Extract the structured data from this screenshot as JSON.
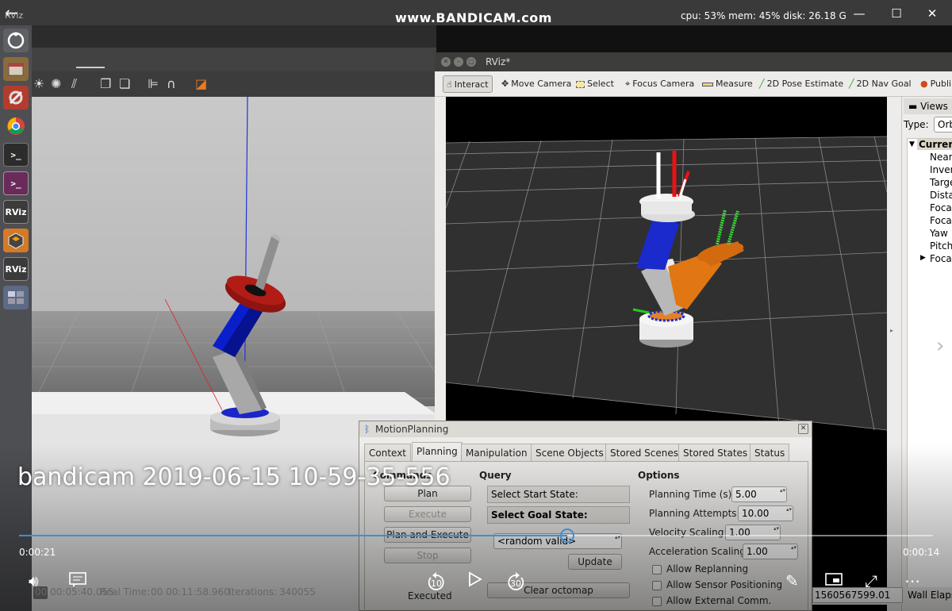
{
  "topbar": {
    "rviz_label": "RViz",
    "watermark": "www.BANDICAM.com",
    "stats": "cpu: 53% mem: 45% disk: 26.18 G",
    "back_icon": "back-arrow-icon",
    "minimize_icon": "minimize-icon",
    "maximize_icon": "maximize-icon",
    "close_icon": "close-icon"
  },
  "launcher": {
    "items": [
      {
        "icon": "ubuntu-dash-icon",
        "label": ""
      },
      {
        "icon": "files-icon",
        "label": ""
      },
      {
        "icon": "settings-tools-icon",
        "label": ""
      },
      {
        "icon": "chrome-icon",
        "label": ""
      },
      {
        "icon": "terminal-icon",
        "label": ""
      },
      {
        "icon": "terminal-alt-icon",
        "label": ""
      },
      {
        "icon": "rviz-icon",
        "label": "RViz"
      },
      {
        "icon": "gazebo-icon",
        "label": ""
      },
      {
        "icon": "rviz-icon",
        "label": "RViz"
      },
      {
        "icon": "workspace-icon",
        "label": ""
      }
    ]
  },
  "gazebo": {
    "status": {
      "sim_time_value": "00 00:05:40.055",
      "real_time_label": "Real Time:",
      "real_time_value": "00 00:11:58.960",
      "iterations_label": "Iterations:",
      "iterations_value": "340055"
    }
  },
  "rviz": {
    "title": "RViz*",
    "tools": [
      {
        "label": "Interact",
        "icon": "interact-icon",
        "active": true
      },
      {
        "label": "Move Camera",
        "icon": "move-camera-icon",
        "active": false
      },
      {
        "label": "Select",
        "icon": "select-icon",
        "active": false
      },
      {
        "label": "Focus Camera",
        "icon": "focus-camera-icon",
        "active": false
      },
      {
        "label": "Measure",
        "icon": "measure-icon",
        "active": false
      },
      {
        "label": "2D Pose Estimate",
        "icon": "pose-estimate-icon",
        "active": false
      },
      {
        "label": "2D Nav Goal",
        "icon": "nav-goal-icon",
        "active": false
      },
      {
        "label": "Publi",
        "icon": "publish-point-icon",
        "active": false
      }
    ],
    "views": {
      "header": "Views",
      "type_label": "Type:",
      "type_value": "Orb",
      "tree": [
        "Current",
        "Near",
        "Inver",
        "Targe",
        "Dista",
        "Foca",
        "Foca",
        "Yaw",
        "Pitch",
        "Foca"
      ]
    },
    "bottom": {
      "wall_time": "1560567599.01",
      "wall_elapsed": "Wall Elaps"
    }
  },
  "motion_planning": {
    "title": "MotionPlanning",
    "tabs": [
      "Context",
      "Planning",
      "Manipulation",
      "Scene Objects",
      "Stored Scenes",
      "Stored States",
      "Status"
    ],
    "selected_tab": "Planning",
    "commands_label": "Commands",
    "buttons": {
      "plan": "Plan",
      "execute": "Execute",
      "plan_and_execute": "Plan and Execute",
      "stop": "Stop",
      "update": "Update",
      "clear_octomap": "Clear octomap"
    },
    "executed_label": "Executed",
    "query": {
      "label": "Query",
      "start_state": "Select Start State:",
      "goal_state": "Select Goal State:",
      "goal_value": "<random valid>"
    },
    "options": {
      "label": "Options",
      "planning_time_label": "Planning Time (s):",
      "planning_time_value": "5.00",
      "planning_attempts_label": "Planning Attempts:",
      "planning_attempts_value": "10.00",
      "velocity_scaling_label": "Velocity Scaling:",
      "velocity_scaling_value": "1.00",
      "accel_scaling_label": "Acceleration Scaling:",
      "accel_scaling_value": "1.00",
      "allow_replanning": "Allow Replanning",
      "allow_sensor": "Allow Sensor Positioning",
      "allow_external": "Allow External Comm."
    }
  },
  "player": {
    "title": "bandicam 2019-06-15 10-59-35-556",
    "elapsed": "0:00:21",
    "remaining": "0:00:14",
    "progress": 0.6,
    "skip_back": "10",
    "skip_forward": "30"
  }
}
